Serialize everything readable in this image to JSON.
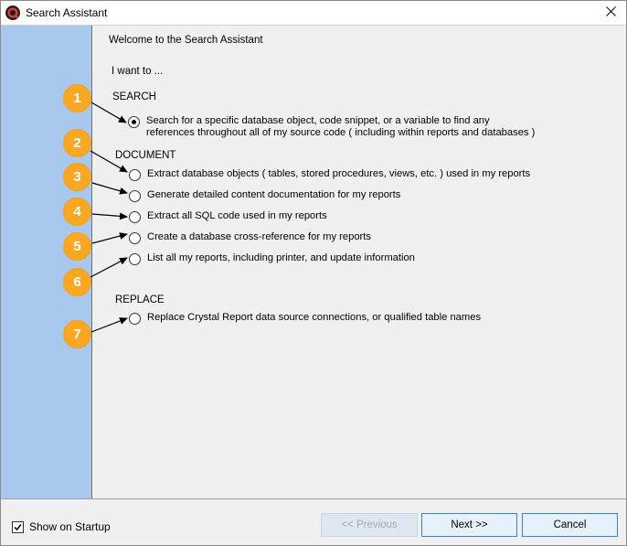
{
  "window": {
    "title": "Search Assistant"
  },
  "content": {
    "welcome": "Welcome to the Search Assistant",
    "intro": "I want to ...",
    "sections": {
      "search": "SEARCH",
      "document": "DOCUMENT",
      "replace": "REPLACE"
    },
    "options": [
      {
        "line1": "Search for a specific database object, code snippet, or a variable to find any",
        "line2": "references throughout all of my source code ( including within reports and databases )",
        "selected": true
      },
      {
        "label": "Extract database objects ( tables, stored procedures, views, etc. ) used in my reports",
        "selected": false
      },
      {
        "label": "Generate detailed content documentation for my reports",
        "selected": false
      },
      {
        "label": "Extract all SQL code used in my reports",
        "selected": false
      },
      {
        "label": "Create a database cross-reference for my reports",
        "selected": false
      },
      {
        "label": "List all my reports, including printer, and update information",
        "selected": false
      },
      {
        "label": "Replace Crystal Report data source connections, or qualified table names",
        "selected": false
      }
    ],
    "badges": [
      "1",
      "2",
      "3",
      "4",
      "5",
      "6",
      "7"
    ],
    "badge_color": "#f9a825"
  },
  "footer": {
    "show_on_startup": "Show on Startup",
    "show_on_startup_checked": true,
    "previous": "<< Previous",
    "next": "Next >>",
    "cancel": "Cancel"
  },
  "colors": {
    "sidebar": "#a9c8ee",
    "window_bg": "#f0f0f0",
    "button_border": "#3a7fd9"
  }
}
